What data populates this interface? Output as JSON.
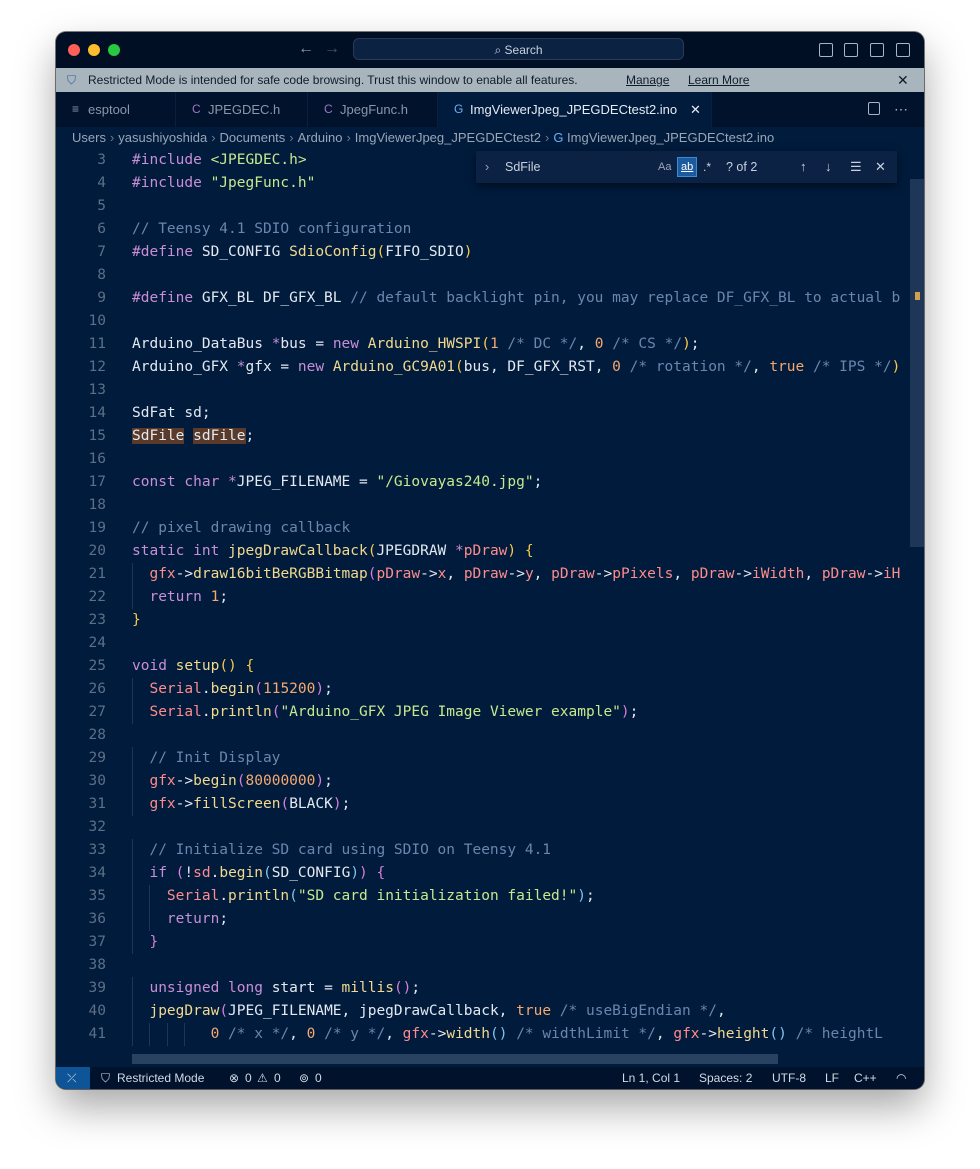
{
  "titlebar": {
    "back_icon": "arrow-left-icon",
    "forward_icon": "arrow-right-icon",
    "search_label": "Search"
  },
  "banner": {
    "message": "Restricted Mode is intended for safe code browsing. Trust this window to enable all features.",
    "manage": "Manage",
    "learn_more": "Learn More"
  },
  "tabs": [
    {
      "label": "esptool",
      "icon": "≡"
    },
    {
      "label": "JPEGDEC.h",
      "icon": "C"
    },
    {
      "label": "JpegFunc.h",
      "icon": "C"
    },
    {
      "label": "ImgViewerJpeg_JPEGDECtest2.ino",
      "icon": "G"
    }
  ],
  "breadcrumbs": [
    "Users",
    "yasushiyoshida",
    "Documents",
    "Arduino",
    "ImgViewerJpeg_JPEGDECtest2",
    "ImgViewerJpeg_JPEGDECtest2.ino"
  ],
  "find": {
    "query": "SdFile",
    "match_case": "Aa",
    "whole_word": "ab",
    "regex": ".*",
    "result": "? of 2"
  },
  "lines": [
    {
      "n": "3",
      "t": ""
    },
    {
      "n": "4",
      "t": ""
    },
    {
      "n": "5",
      "t": ""
    },
    {
      "n": "6",
      "t": ""
    },
    {
      "n": "7",
      "t": ""
    },
    {
      "n": "8",
      "t": ""
    },
    {
      "n": "9",
      "t": ""
    },
    {
      "n": "10",
      "t": ""
    },
    {
      "n": "11",
      "t": ""
    },
    {
      "n": "12",
      "t": ""
    },
    {
      "n": "13",
      "t": ""
    },
    {
      "n": "14",
      "t": ""
    },
    {
      "n": "15",
      "t": ""
    },
    {
      "n": "16",
      "t": ""
    },
    {
      "n": "17",
      "t": ""
    },
    {
      "n": "18",
      "t": ""
    },
    {
      "n": "19",
      "t": ""
    },
    {
      "n": "20",
      "t": ""
    },
    {
      "n": "21",
      "t": ""
    },
    {
      "n": "22",
      "t": ""
    },
    {
      "n": "23",
      "t": ""
    },
    {
      "n": "24",
      "t": ""
    },
    {
      "n": "25",
      "t": ""
    },
    {
      "n": "26",
      "t": ""
    },
    {
      "n": "27",
      "t": ""
    },
    {
      "n": "28",
      "t": ""
    },
    {
      "n": "29",
      "t": ""
    },
    {
      "n": "30",
      "t": ""
    },
    {
      "n": "31",
      "t": ""
    },
    {
      "n": "32",
      "t": ""
    },
    {
      "n": "33",
      "t": ""
    },
    {
      "n": "34",
      "t": ""
    },
    {
      "n": "35",
      "t": ""
    },
    {
      "n": "36",
      "t": ""
    },
    {
      "n": "37",
      "t": ""
    },
    {
      "n": "38",
      "t": ""
    },
    {
      "n": "39",
      "t": ""
    },
    {
      "n": "40",
      "t": ""
    },
    {
      "n": "41",
      "t": ""
    }
  ],
  "code": [
    [
      [
        "pp",
        "#include "
      ],
      [
        "str",
        "<JPEGDEC.h>"
      ]
    ],
    [
      [
        "pp",
        "#include "
      ],
      [
        "str",
        "\"JpegFunc.h\""
      ]
    ],
    [],
    [
      [
        "cm",
        "// Teensy 4.1 SDIO configuration"
      ]
    ],
    [
      [
        "pp",
        "#define "
      ],
      [
        "",
        "SD_CONFIG "
      ],
      [
        "fn",
        "SdioConfig"
      ],
      [
        "br",
        "("
      ],
      [
        "",
        "FIFO_SDIO"
      ],
      [
        "br",
        ")"
      ]
    ],
    [],
    [
      [
        "pp",
        "#define "
      ],
      [
        "",
        "GFX_BL DF_GFX_BL "
      ],
      [
        "cm",
        "// default backlight pin, you may replace DF_GFX_BL to actual b"
      ]
    ],
    [],
    [
      [
        "",
        "Arduino_DataBus "
      ],
      [
        "kw",
        "*"
      ],
      [
        "",
        "bus = "
      ],
      [
        "kw",
        "new "
      ],
      [
        "fn",
        "Arduino_HWSPI"
      ],
      [
        "br",
        "("
      ],
      [
        "num",
        "1"
      ],
      [
        "cm",
        " /* DC */"
      ],
      [
        "",
        ", "
      ],
      [
        "num",
        "0"
      ],
      [
        "cm",
        " /* CS */"
      ],
      [
        "br",
        ")"
      ],
      [
        "",
        ";"
      ]
    ],
    [
      [
        "",
        "Arduino_GFX "
      ],
      [
        "kw",
        "*"
      ],
      [
        "",
        "gfx = "
      ],
      [
        "kw",
        "new "
      ],
      [
        "fn",
        "Arduino_GC9A01"
      ],
      [
        "br",
        "("
      ],
      [
        "",
        "bus, DF_GFX_RST, "
      ],
      [
        "num",
        "0"
      ],
      [
        "cm",
        " /* rotation */"
      ],
      [
        "",
        ", "
      ],
      [
        "num",
        "true"
      ],
      [
        "cm",
        " /* IPS */"
      ],
      [
        "br",
        ")"
      ]
    ],
    [],
    [
      [
        "",
        "SdFat sd;"
      ]
    ],
    [
      [
        "hl",
        "SdFile"
      ],
      [
        "",
        " "
      ],
      [
        "hl",
        "sdFile"
      ],
      [
        "",
        ";"
      ]
    ],
    [],
    [
      [
        "kw",
        "const "
      ],
      [
        "kw",
        "char "
      ],
      [
        "kw",
        "*"
      ],
      [
        "",
        "JPEG_FILENAME = "
      ],
      [
        "str",
        "\"/Giovayas240.jpg\""
      ],
      [
        "",
        ";"
      ]
    ],
    [],
    [
      [
        "cm",
        "// pixel drawing callback"
      ]
    ],
    [
      [
        "kw",
        "static "
      ],
      [
        "kw",
        "int "
      ],
      [
        "fn",
        "jpegDrawCallback"
      ],
      [
        "br",
        "("
      ],
      [
        "",
        "JPEGDRAW "
      ],
      [
        "kw",
        "*"
      ],
      [
        "obj",
        "pDraw"
      ],
      [
        "br",
        ") {"
      ]
    ],
    [
      [
        "",
        "  "
      ],
      [
        "obj",
        "gfx"
      ],
      [
        "",
        "->"
      ],
      [
        "fn",
        "draw16bitBeRGBBitmap"
      ],
      [
        "br2",
        "("
      ],
      [
        "obj",
        "pDraw"
      ],
      [
        "",
        "->"
      ],
      [
        "obj",
        "x"
      ],
      [
        "",
        ", "
      ],
      [
        "obj",
        "pDraw"
      ],
      [
        "",
        "->"
      ],
      [
        "obj",
        "y"
      ],
      [
        "",
        ", "
      ],
      [
        "obj",
        "pDraw"
      ],
      [
        "",
        "->"
      ],
      [
        "obj",
        "pPixels"
      ],
      [
        "",
        ", "
      ],
      [
        "obj",
        "pDraw"
      ],
      [
        "",
        "->"
      ],
      [
        "obj",
        "iWidth"
      ],
      [
        "",
        ", "
      ],
      [
        "obj",
        "pDraw"
      ],
      [
        "",
        "->"
      ],
      [
        "obj",
        "iH"
      ]
    ],
    [
      [
        "",
        "  "
      ],
      [
        "kw",
        "return "
      ],
      [
        "num",
        "1"
      ],
      [
        "",
        ";"
      ]
    ],
    [
      [
        "br",
        "}"
      ]
    ],
    [],
    [
      [
        "kw",
        "void "
      ],
      [
        "fn",
        "setup"
      ],
      [
        "br",
        "() {"
      ]
    ],
    [
      [
        "",
        "  "
      ],
      [
        "obj",
        "Serial"
      ],
      [
        "",
        "."
      ],
      [
        "fn",
        "begin"
      ],
      [
        "br2",
        "("
      ],
      [
        "num",
        "115200"
      ],
      [
        "br2",
        ")"
      ],
      [
        "",
        ";"
      ]
    ],
    [
      [
        "",
        "  "
      ],
      [
        "obj",
        "Serial"
      ],
      [
        "",
        "."
      ],
      [
        "fn",
        "println"
      ],
      [
        "br2",
        "("
      ],
      [
        "str",
        "\"Arduino_GFX JPEG Image Viewer example\""
      ],
      [
        "br2",
        ")"
      ],
      [
        "",
        ";"
      ]
    ],
    [],
    [
      [
        "",
        "  "
      ],
      [
        "cm",
        "// Init Display"
      ]
    ],
    [
      [
        "",
        "  "
      ],
      [
        "obj",
        "gfx"
      ],
      [
        "",
        "->"
      ],
      [
        "fn",
        "begin"
      ],
      [
        "br2",
        "("
      ],
      [
        "num",
        "80000000"
      ],
      [
        "br2",
        ")"
      ],
      [
        "",
        ";"
      ]
    ],
    [
      [
        "",
        "  "
      ],
      [
        "obj",
        "gfx"
      ],
      [
        "",
        "->"
      ],
      [
        "fn",
        "fillScreen"
      ],
      [
        "br2",
        "("
      ],
      [
        "",
        "BLACK"
      ],
      [
        "br2",
        ")"
      ],
      [
        "",
        ";"
      ]
    ],
    [],
    [
      [
        "",
        "  "
      ],
      [
        "cm",
        "// Initialize SD card using SDIO on Teensy 4.1"
      ]
    ],
    [
      [
        "",
        "  "
      ],
      [
        "kw",
        "if "
      ],
      [
        "br2",
        "("
      ],
      [
        "",
        "!"
      ],
      [
        "obj",
        "sd"
      ],
      [
        "",
        "."
      ],
      [
        "fn",
        "begin"
      ],
      [
        "ty",
        "("
      ],
      [
        "",
        "SD_CONFIG"
      ],
      [
        "ty",
        ")"
      ],
      [
        "br2",
        ") {"
      ]
    ],
    [
      [
        "",
        "    "
      ],
      [
        "obj",
        "Serial"
      ],
      [
        "",
        "."
      ],
      [
        "fn",
        "println"
      ],
      [
        "ty",
        "("
      ],
      [
        "str",
        "\"SD card initialization failed!\""
      ],
      [
        "ty",
        ")"
      ],
      [
        "",
        ";"
      ]
    ],
    [
      [
        "",
        "    "
      ],
      [
        "kw",
        "return"
      ],
      [
        "",
        ";"
      ]
    ],
    [
      [
        "",
        "  "
      ],
      [
        "br2",
        "}"
      ]
    ],
    [],
    [
      [
        "",
        "  "
      ],
      [
        "kw",
        "unsigned "
      ],
      [
        "kw",
        "long "
      ],
      [
        "",
        "start = "
      ],
      [
        "fn",
        "millis"
      ],
      [
        "br2",
        "()"
      ],
      [
        "",
        ";"
      ]
    ],
    [
      [
        "",
        "  "
      ],
      [
        "fn",
        "jpegDraw"
      ],
      [
        "br2",
        "("
      ],
      [
        "",
        "JPEG_FILENAME, jpegDrawCallback, "
      ],
      [
        "num",
        "true"
      ],
      [
        "cm",
        " /* useBigEndian */"
      ],
      [
        "",
        ","
      ]
    ],
    [
      [
        "",
        "         "
      ],
      [
        "num",
        "0"
      ],
      [
        "cm",
        " /* x */"
      ],
      [
        "",
        ", "
      ],
      [
        "num",
        "0"
      ],
      [
        "cm",
        " /* y */"
      ],
      [
        "",
        ", "
      ],
      [
        "obj",
        "gfx"
      ],
      [
        "",
        "->"
      ],
      [
        "fn",
        "width"
      ],
      [
        "ty",
        "()"
      ],
      [
        "cm",
        " /* widthLimit */"
      ],
      [
        "",
        ", "
      ],
      [
        "obj",
        "gfx"
      ],
      [
        "",
        "->"
      ],
      [
        "fn",
        "height"
      ],
      [
        "ty",
        "()"
      ],
      [
        "cm",
        " /* heightL"
      ]
    ]
  ],
  "status": {
    "restricted": "Restricted Mode",
    "errors": "0",
    "warnings": "0",
    "ports": "0",
    "position": "Ln 1, Col 1",
    "spaces": "Spaces: 2",
    "encoding": "UTF-8",
    "eol": "LF",
    "language": "C++"
  }
}
